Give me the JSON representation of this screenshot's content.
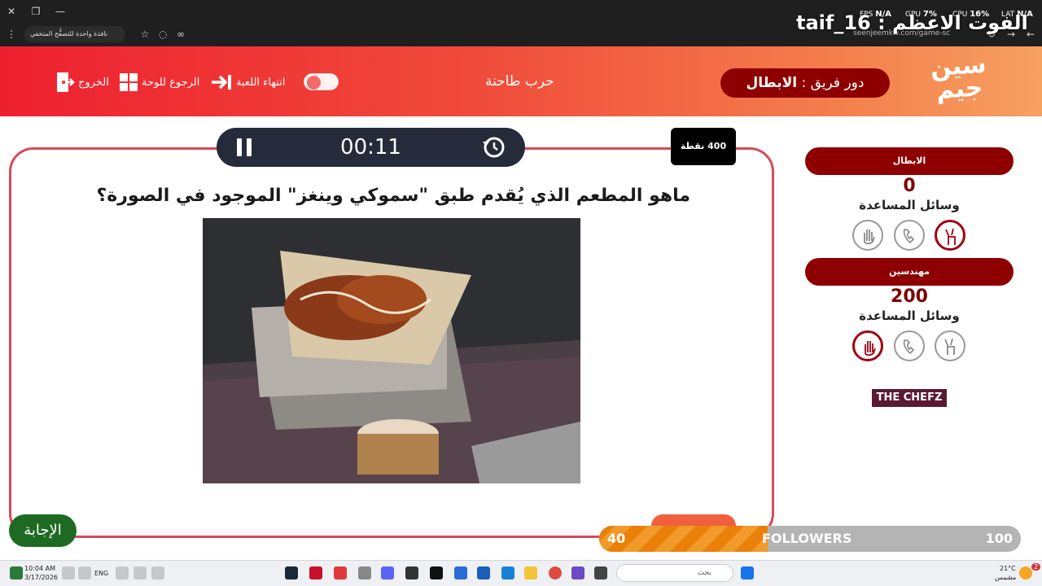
{
  "browser": {
    "tab_pill": "نافذة واحدة للتصفُّح المتخفي",
    "url": "seenjeemkw.com/game-sc",
    "overlay_title": "taif_16 : الفوت الاعظم",
    "perf": {
      "fps_label": "FPS",
      "fps_value": "N/A",
      "gpu_label": "GPU",
      "gpu_value": "7%",
      "cpu_label": "CPU",
      "cpu_value": "16%",
      "lat_label": "LAT",
      "lat_value": "N/A"
    }
  },
  "header": {
    "logo_text": "سين جيم",
    "turn_label": "دور فريق :",
    "turn_team": "الابطال",
    "game_name": "حرب طاحنة",
    "end_game": "انتهاء اللعبة",
    "back_to_board": "الرجوع للوحة",
    "exit": "الخروج"
  },
  "question": {
    "timer": "00:11",
    "points": "400 نقطة",
    "text": "ماهو المطعم الذي يُقدم طبق \"سموكي وينغز\" الموجود في الصورة؟",
    "answer_button": "الإجابة"
  },
  "teams": [
    {
      "name": "الابطال",
      "score": "0",
      "aids_label": "وسائل المساعدة"
    },
    {
      "name": "مهندسين",
      "score": "200",
      "aids_label": "وسائل المساعدة"
    }
  ],
  "sponsor": "THE CHEFZ",
  "followers": {
    "current": "40",
    "label": "FOLLOWERS",
    "max": "100",
    "fraction": 0.4
  },
  "taskbar": {
    "time": "10:04 AM",
    "date": "3/17/2026",
    "lang": "ENG",
    "search_placeholder": "بحث",
    "weather_temp": "21°C",
    "weather_desc": "مشمس",
    "badge": "2"
  }
}
